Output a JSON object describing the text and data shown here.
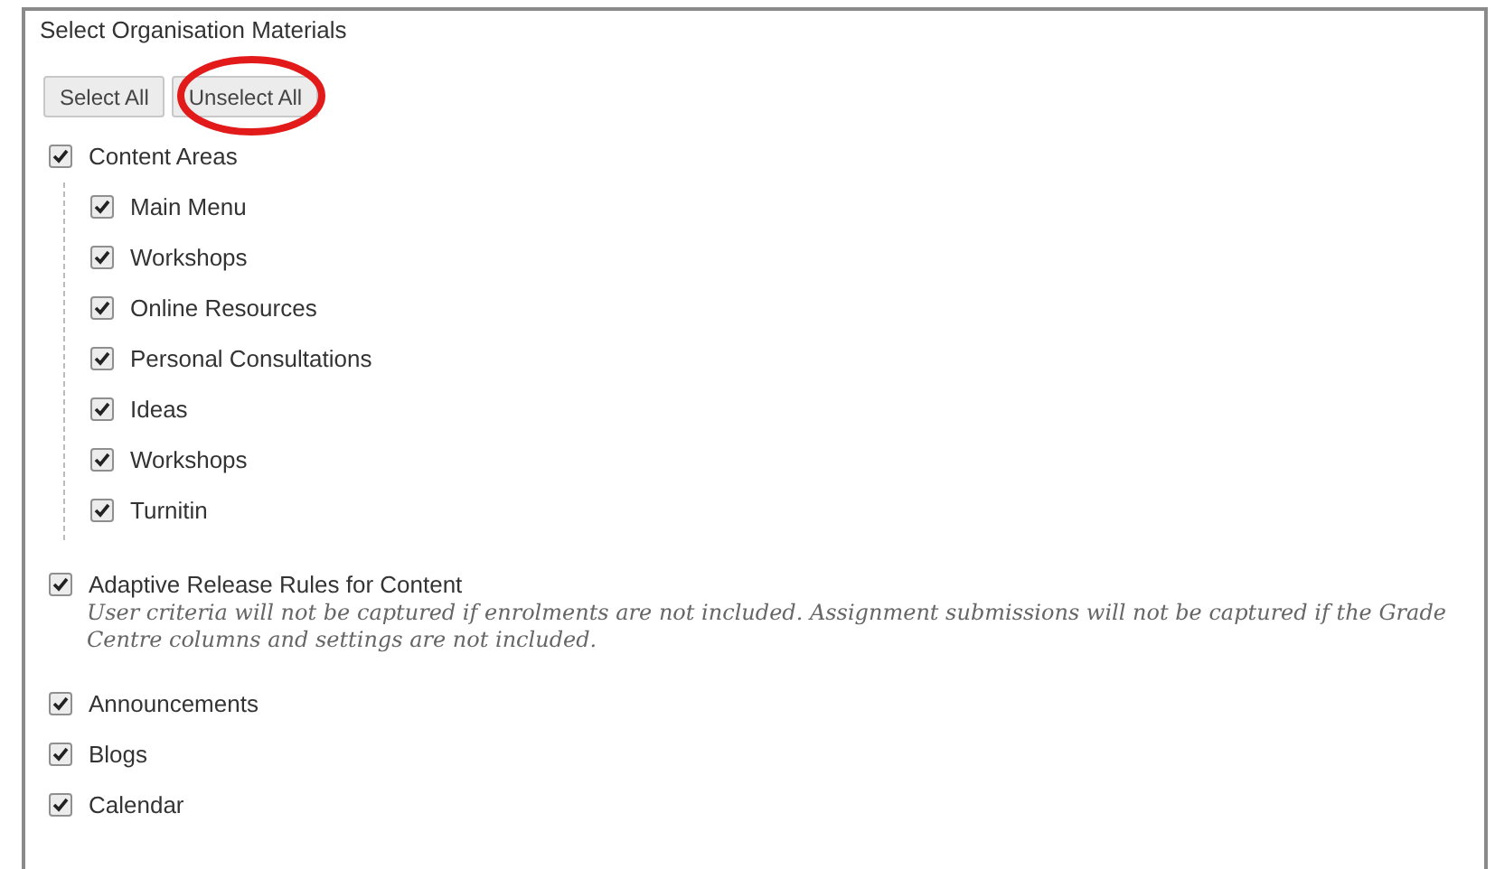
{
  "section": {
    "title": "Select Organisation Materials"
  },
  "buttons": [
    {
      "label": "Select All"
    },
    {
      "label": "Unselect All",
      "highlighted": true
    }
  ],
  "groups": [
    {
      "label": "Content Areas",
      "checked": true,
      "children": [
        {
          "label": "Main Menu",
          "checked": true
        },
        {
          "label": "Workshops",
          "checked": true
        },
        {
          "label": "Online Resources",
          "checked": true
        },
        {
          "label": "Personal Consultations",
          "checked": true
        },
        {
          "label": "Ideas",
          "checked": true
        },
        {
          "label": "Workshops",
          "checked": true
        },
        {
          "label": "Turnitin",
          "checked": true
        }
      ]
    },
    {
      "label": "Adaptive Release Rules for Content",
      "checked": true,
      "note": "User criteria will not be captured if enrolments are not included. Assignment submissions will not be captured if the Grade Centre columns and settings are not included."
    },
    {
      "label": "Announcements",
      "checked": true
    },
    {
      "label": "Blogs",
      "checked": true
    },
    {
      "label": "Calendar",
      "checked": true
    }
  ]
}
